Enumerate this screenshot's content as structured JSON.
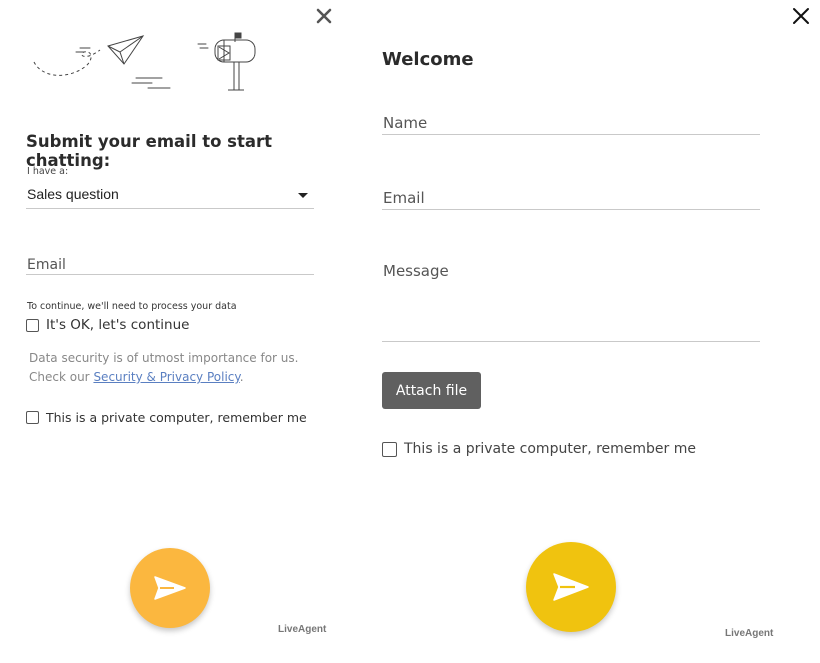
{
  "left_form": {
    "heading": "Submit your email to start chatting:",
    "question_type_label": "I have a:",
    "question_type_value": "Sales question",
    "email_placeholder": "Email",
    "consent_note": "To continue, we'll need to process your data",
    "consent_label": "It's OK, let's continue",
    "security_text_line1": "Data security is of utmost importance for us.",
    "security_text_prefix": "Check our ",
    "security_link": "Security & Privacy Policy",
    "security_text_suffix": ".",
    "remember_label": "This is a private computer, remember me",
    "brand": "LiveAgent",
    "send_button_color": "#fbb73f",
    "close_icon": "close-icon"
  },
  "right_form": {
    "heading": "Welcome",
    "name_placeholder": "Name",
    "email_placeholder": "Email",
    "message_placeholder": "Message",
    "attach_label": "Attach file",
    "remember_label": "This is a private computer, remember me",
    "brand": "LiveAgent",
    "send_button_color": "#f0c30f",
    "attach_button_color": "#606060",
    "close_icon": "close-icon"
  }
}
